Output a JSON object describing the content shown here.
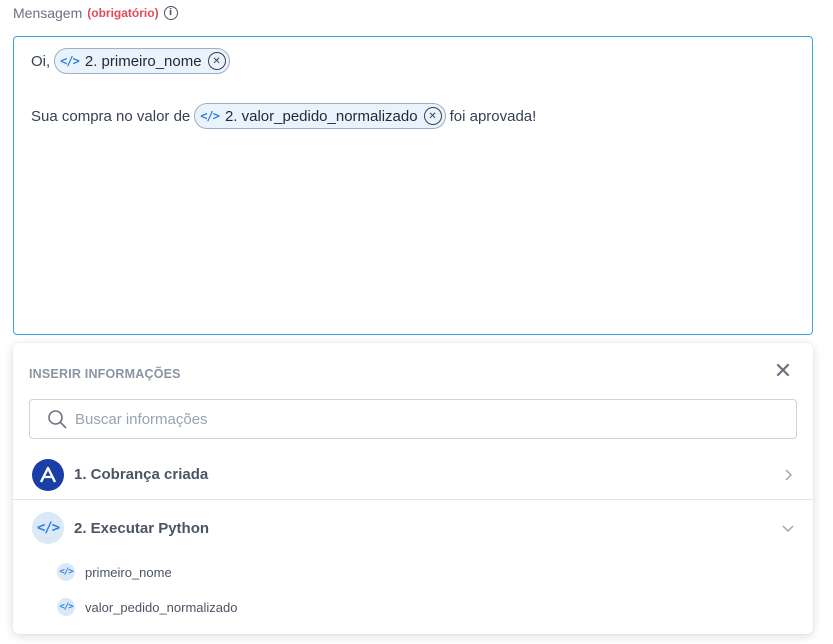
{
  "field": {
    "label": "Mensagem",
    "required_label": "(obrigatório)",
    "info_icon": "info-icon"
  },
  "editor": {
    "line1": {
      "prefix": "Oi,",
      "chip": "2. primeiro_nome"
    },
    "line2": {
      "prefix": "Sua compra no valor de",
      "chip": "2. valor_pedido_normalizado",
      "suffix": "foi aprovada!"
    },
    "chip_icon": "code-icon",
    "chip_remove_icon": "close-circle-icon"
  },
  "panel": {
    "title": "INSERIR INFORMAÇÕES",
    "close_icon": "close-icon",
    "search": {
      "placeholder": "Buscar informações",
      "value": ""
    },
    "steps": [
      {
        "label": "1. Cobrança criada",
        "icon": "app-logo-icon",
        "state": "collapsed"
      },
      {
        "label": "2. Executar Python",
        "icon": "code-icon",
        "state": "expanded"
      }
    ],
    "fields": [
      {
        "label": "primeiro_nome",
        "icon": "code-icon"
      },
      {
        "label": "valor_pedido_normalizado",
        "icon": "code-icon"
      }
    ]
  },
  "colors": {
    "accent": "#2b7de0",
    "editor_border": "#3aa6e0",
    "required": "#e04b5a",
    "chip_bg": "#eaf3fb",
    "logo_bg": "#1a3fa8"
  }
}
